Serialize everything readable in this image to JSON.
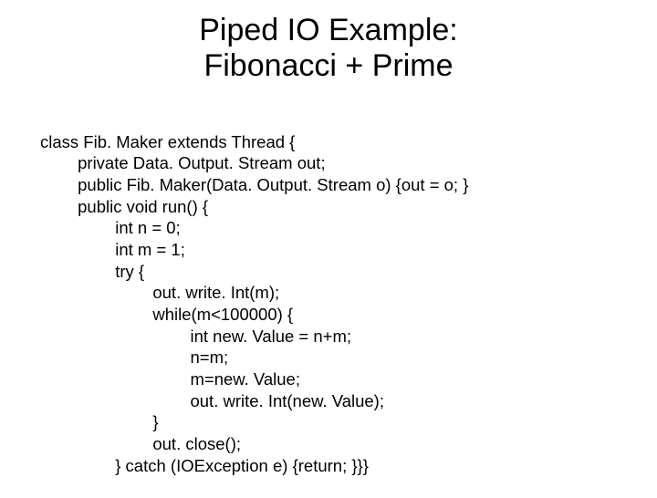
{
  "title": {
    "line1": "Piped IO Example:",
    "line2": "Fibonacci + Prime"
  },
  "code": {
    "l1": "class Fib. Maker extends Thread {",
    "l2": "        private Data. Output. Stream out;",
    "l3": "        public Fib. Maker(Data. Output. Stream o) {out = o; }",
    "l4": "        public void run() {",
    "l5": "                int n = 0;",
    "l6": "                int m = 1;",
    "l7": "                try {",
    "l8": "                        out. write. Int(m);",
    "l9": "                        while(m<100000) {",
    "l10": "                                int new. Value = n+m;",
    "l11": "                                n=m;",
    "l12": "                                m=new. Value;",
    "l13": "                                out. write. Int(new. Value);",
    "l14": "                        }",
    "l15": "                        out. close();",
    "l16": "                } catch (IOException e) {return; }}}"
  }
}
